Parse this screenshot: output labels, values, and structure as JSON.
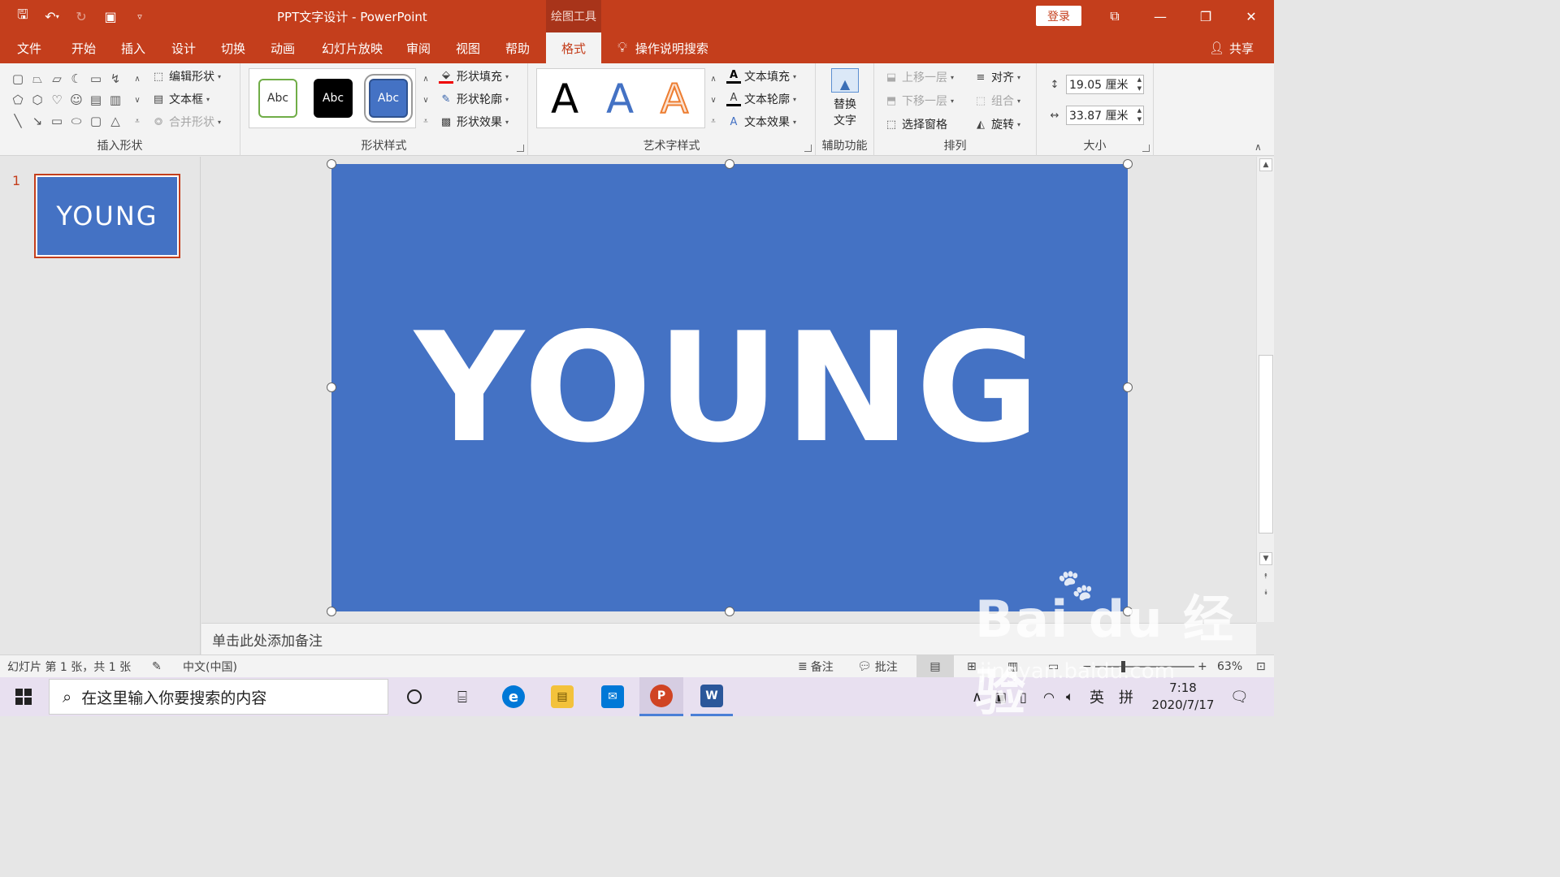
{
  "titlebar": {
    "doc_title": "PPT文字设计  -  PowerPoint",
    "context_tab": "绘图工具",
    "login": "登录",
    "accent": "#c43e1c"
  },
  "tabs": [
    "文件",
    "开始",
    "插入",
    "设计",
    "切换",
    "动画",
    "幻灯片放映",
    "审阅",
    "视图",
    "帮助",
    "格式"
  ],
  "active_tab": "格式",
  "tell_me": "操作说明搜索",
  "share": "共享",
  "ribbon": {
    "insert_shapes": {
      "label": "插入形状",
      "edit_shape": "编辑形状",
      "textbox": "文本框",
      "merge_shapes": "合并形状"
    },
    "shape_styles": {
      "label": "形状样式",
      "samples": [
        "Abc",
        "Abc",
        "Abc"
      ],
      "fill": "形状填充",
      "outline": "形状轮廓",
      "effects": "形状效果"
    },
    "wordart_styles": {
      "label": "艺术字样式",
      "samples": [
        "A",
        "A",
        "A"
      ],
      "text_fill": "文本填充",
      "text_outline": "文本轮廓",
      "text_effects": "文本效果"
    },
    "accessibility": {
      "label": "辅助功能",
      "alt_text_line1": "替换",
      "alt_text_line2": "文字"
    },
    "arrange": {
      "label": "排列",
      "bring_forward": "上移一层",
      "send_backward": "下移一层",
      "selection_pane": "选择窗格",
      "align": "对齐",
      "group": "组合",
      "rotate": "旋转"
    },
    "size": {
      "label": "大小",
      "height": "19.05 厘米",
      "width": "33.87 厘米"
    }
  },
  "slides_pane": {
    "number": "1",
    "thumb_text": "YOUNG"
  },
  "slide": {
    "text": "YOUNG",
    "background": "#4472c4"
  },
  "notes_placeholder": "单击此处添加备注",
  "statusbar": {
    "slide_info": "幻灯片 第 1 张，共 1 张",
    "language": "中文(中国)",
    "notes": "备注",
    "comments": "批注",
    "zoom": "63%"
  },
  "taskbar": {
    "search_placeholder": "在这里输入你要搜索的内容",
    "ime_lang": "英",
    "ime_mode": "拼",
    "time": "7:18",
    "date": "2020/7/17"
  },
  "watermark": {
    "main": "Bai du 经验",
    "sub": "jingyan.baidu.com"
  }
}
